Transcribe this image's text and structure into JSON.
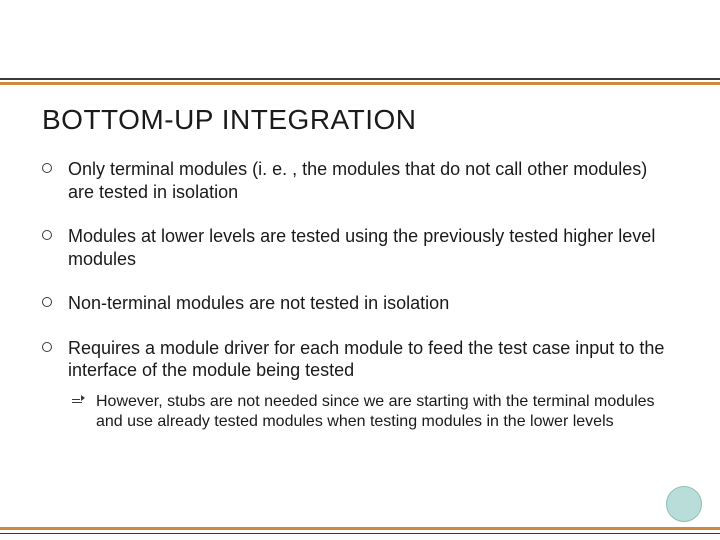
{
  "title": "BOTTOM-UP INTEGRATION",
  "bullets": {
    "b1": "Only terminal modules (i. e. , the modules that do not call other modules) are tested in isolation",
    "b2": "Modules at lower levels are tested using the previously tested higher level modules",
    "b3": "Non-terminal modules are not tested in isolation",
    "b4": "Requires a module driver for each module to feed the test case input to the interface of the module being tested",
    "b4_sub1": "However, stubs are not needed since we are starting with the terminal modules and use already tested modules when testing modules in the lower levels"
  },
  "colors": {
    "accent": "#d18a3a",
    "rule": "#3a3a3a",
    "circleFill": "#b9ded9"
  }
}
